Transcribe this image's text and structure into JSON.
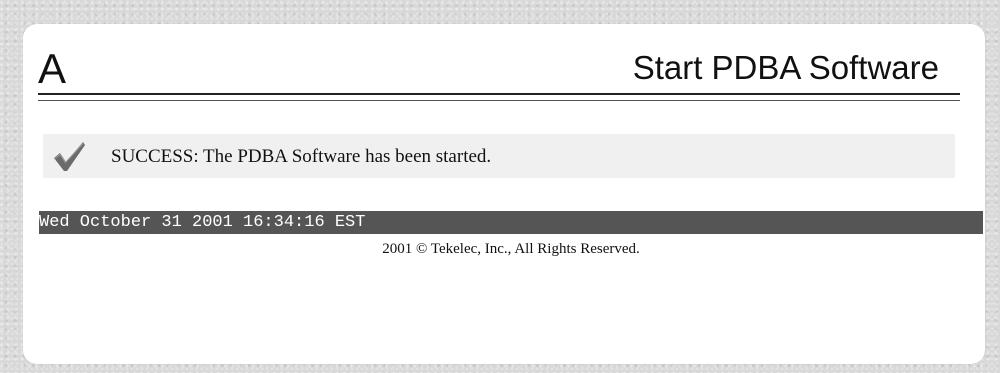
{
  "header": {
    "letter": "A",
    "title": "Start PDBA Software"
  },
  "message": {
    "icon": "checkmark-icon",
    "text": "SUCCESS: The PDBA Software has been started."
  },
  "status_bar": {
    "timestamp": "Wed October 31 2001 16:34:16 EST"
  },
  "footer": {
    "copyright": "2001 © Tekelec, Inc., All Rights Reserved."
  },
  "colors": {
    "status_bar_bg": "#555555",
    "message_bg": "#f0f0f0",
    "check_color": "#6b6b6b"
  }
}
